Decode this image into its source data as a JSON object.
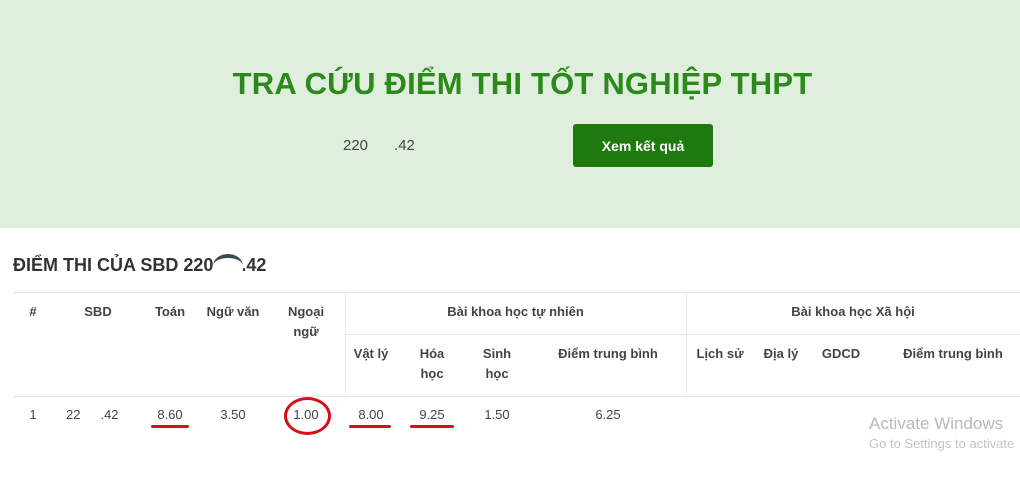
{
  "hero": {
    "title": "TRA CỨU ĐIỂM THI TỐT NGHIỆP THPT",
    "search_value": "220",
    "search_value_suffix": ".42",
    "button_label": "Xem kết quả"
  },
  "result": {
    "title": "ĐIỂM THI CỦA SBD 220",
    "title_suffix": ".42"
  },
  "table": {
    "headers": {
      "index": "#",
      "sbd": "SBD",
      "toan": "Toán",
      "ngu_van": "Ngữ văn",
      "ngoai_ngu": "Ngoại ngữ",
      "khtn_group": "Bài khoa học tự nhiên",
      "khxh_group": "Bài khoa học Xã hội",
      "vat_ly": "Vật lý",
      "hoa_hoc": "Hóa học",
      "sinh_hoc": "Sinh học",
      "diem_tb_tn": "Điểm trung bình",
      "lich_su": "Lịch sử",
      "dia_ly": "Địa lý",
      "gdcd": "GDCD",
      "diem_tb_xh": "Điểm trung bình"
    },
    "row": {
      "index": "1",
      "sbd_prefix": "22",
      "sbd_suffix": ".42",
      "toan": "8.60",
      "ngu_van": "3.50",
      "ngoai_ngu": "1.00",
      "vat_ly": "8.00",
      "hoa_hoc": "9.25",
      "sinh_hoc": "1.50",
      "diem_tb_tn": "6.25"
    }
  },
  "watermark": {
    "line1": "Activate Windows",
    "line2": "Go to Settings to activate"
  },
  "colors": {
    "brand_green": "#2b8a1a",
    "button_green": "#1e7a0f",
    "hero_bg": "#dfeedd",
    "annotation_red": "#d4101a"
  }
}
